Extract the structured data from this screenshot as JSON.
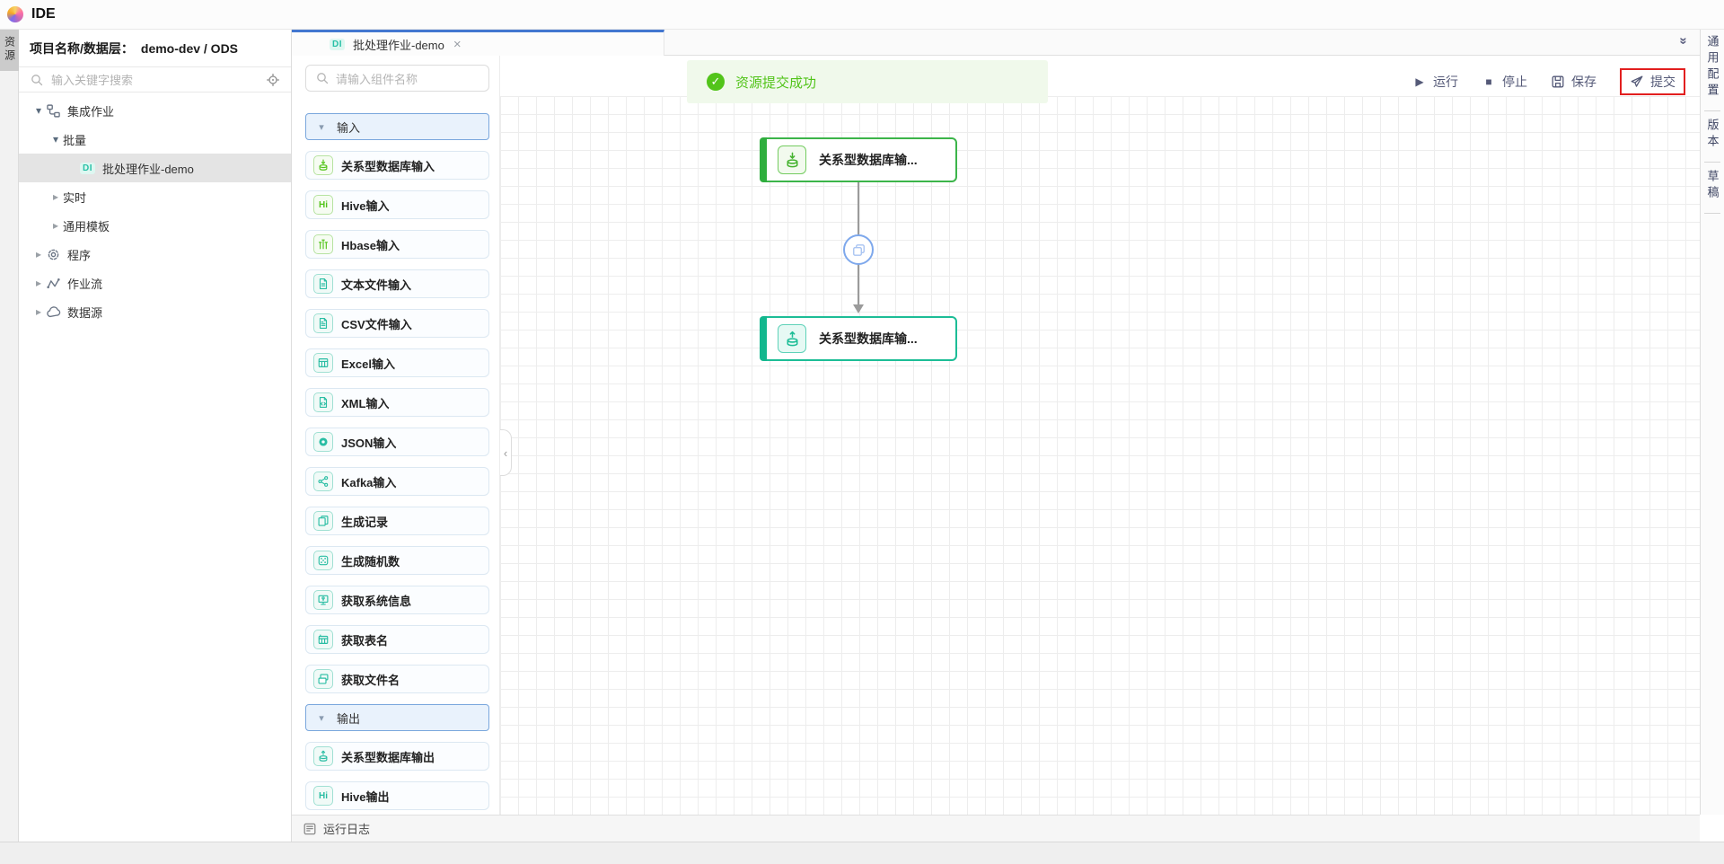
{
  "app": {
    "title": "IDE"
  },
  "left_strip": {
    "resources_tab": "资源"
  },
  "project_panel": {
    "header_label": "项目名称/数据层：",
    "header_value": "demo-dev / ODS",
    "search_placeholder": "输入关键字搜索",
    "search_icon": "search-icon",
    "locate_icon": "locate-icon",
    "tree": [
      {
        "label": "集成作业",
        "level": 0,
        "caret": "down",
        "icon": "integration-icon"
      },
      {
        "label": "批量",
        "level": 1,
        "caret": "down"
      },
      {
        "label": "批处理作业-demo",
        "level": 2,
        "badge": "DI",
        "selected": true
      },
      {
        "label": "实时",
        "level": 1,
        "caret": "right"
      },
      {
        "label": "通用模板",
        "level": 1,
        "caret": "right"
      },
      {
        "label": "程序",
        "level": 0,
        "caret": "right",
        "icon": "gear-icon"
      },
      {
        "label": "作业流",
        "level": 0,
        "caret": "right",
        "icon": "workflow-icon"
      },
      {
        "label": "数据源",
        "level": 0,
        "caret": "right",
        "icon": "datasource-icon"
      }
    ]
  },
  "tabbar": {
    "tabs": [
      {
        "badge": "DI",
        "label": "批处理作业-demo",
        "close": "×",
        "active": true
      }
    ],
    "collapse_icon": "chevrons-down-icon"
  },
  "palette": {
    "search_placeholder": "请输入组件名称",
    "search_icon": "search-icon",
    "sections": [
      {
        "label": "输入",
        "expanded": true,
        "items": [
          {
            "label": "关系型数据库输入",
            "icon": "database-input-icon",
            "color": "green"
          },
          {
            "label": "Hive输入",
            "icon": "hive-icon",
            "color": "green"
          },
          {
            "label": "Hbase输入",
            "icon": "hbase-icon",
            "color": "green"
          },
          {
            "label": "文本文件输入",
            "icon": "text-file-icon",
            "color": "teal"
          },
          {
            "label": "CSV文件输入",
            "icon": "csv-file-icon",
            "color": "teal"
          },
          {
            "label": "Excel输入",
            "icon": "excel-icon",
            "color": "teal"
          },
          {
            "label": "XML输入",
            "icon": "xml-file-icon",
            "color": "teal"
          },
          {
            "label": "JSON输入",
            "icon": "json-icon",
            "color": "teal"
          },
          {
            "label": "Kafka输入",
            "icon": "kafka-icon",
            "color": "teal"
          },
          {
            "label": "生成记录",
            "icon": "records-icon",
            "color": "teal"
          },
          {
            "label": "生成随机数",
            "icon": "dice-icon",
            "color": "teal"
          },
          {
            "label": "获取系统信息",
            "icon": "system-info-icon",
            "color": "teal"
          },
          {
            "label": "获取表名",
            "icon": "table-name-icon",
            "color": "teal"
          },
          {
            "label": "获取文件名",
            "icon": "file-name-icon",
            "color": "teal"
          }
        ]
      },
      {
        "label": "输出",
        "expanded": true,
        "items": [
          {
            "label": "关系型数据库输出",
            "icon": "database-output-icon",
            "color": "teal"
          },
          {
            "label": "Hive输出",
            "icon": "hive-icon",
            "color": "teal"
          }
        ]
      }
    ]
  },
  "canvas": {
    "toast": {
      "text": "资源提交成功",
      "icon": "check-icon"
    },
    "toolbar": [
      {
        "label": "运行",
        "icon": "run-icon"
      },
      {
        "label": "停止",
        "icon": "stop-icon"
      },
      {
        "label": "保存",
        "icon": "save-icon"
      },
      {
        "label": "提交",
        "icon": "submit-icon",
        "highlighted": true
      }
    ],
    "nodes": [
      {
        "label": "关系型数据库输...",
        "icon": "database-input-icon",
        "color": "green"
      },
      {
        "label": "关系型数据库输...",
        "icon": "database-output-icon",
        "color": "teal"
      }
    ],
    "edge": {
      "icon": "copy-icon"
    }
  },
  "runlog": {
    "label": "运行日志",
    "icon": "log-icon"
  },
  "right_panel": {
    "tabs": [
      "通用配置",
      "版本",
      "草稿"
    ]
  },
  "colors": {
    "accent_blue": "#4377d0",
    "success_green": "#52c41a",
    "teal": "#29bda3",
    "node_green": "#3cb54a",
    "node_teal": "#1cbd96",
    "toolbar_text": "#555a78",
    "highlight_red": "#e21f1f"
  }
}
